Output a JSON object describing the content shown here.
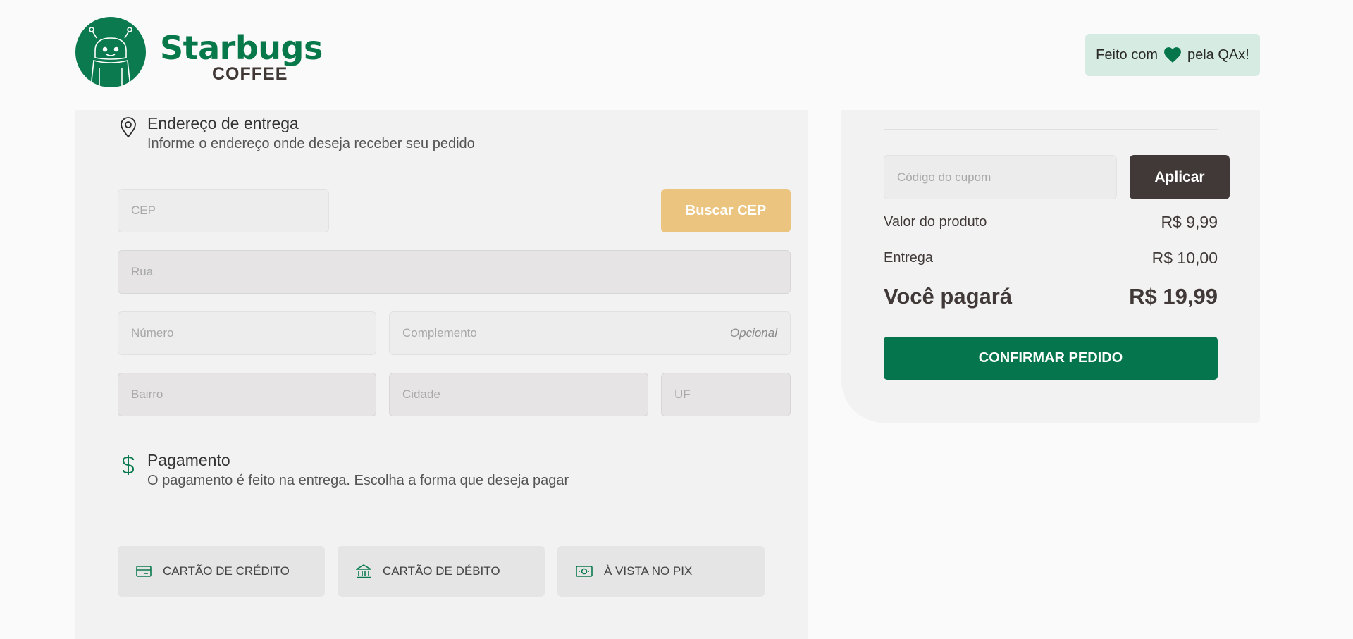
{
  "brand": {
    "name": "Starbugs",
    "sub": "COFFEE"
  },
  "badge": {
    "prefix": "Feito com",
    "suffix": "pela QAx!",
    "icon": "heart-icon"
  },
  "address": {
    "title": "Endereço de entrega",
    "subtitle": "Informe o endereço onde deseja receber seu pedido",
    "icon": "map-pin-icon",
    "fields": {
      "cep": "CEP",
      "rua": "Rua",
      "numero": "Número",
      "complemento": "Complemento",
      "complemento_tag": "Opcional",
      "bairro": "Bairro",
      "cidade": "Cidade",
      "uf": "UF"
    },
    "search_button": "Buscar CEP"
  },
  "payment": {
    "title": "Pagamento",
    "subtitle": "O pagamento é feito na entrega. Escolha a forma que deseja pagar",
    "icon": "dollar-icon",
    "options": [
      {
        "label": "CARTÃO DE CRÉDITO",
        "icon": "credit-card-icon"
      },
      {
        "label": "CARTÃO DE DÉBITO",
        "icon": "bank-icon"
      },
      {
        "label": "À VISTA NO PIX",
        "icon": "money-icon"
      }
    ]
  },
  "summary": {
    "coupon_placeholder": "Código do cupom",
    "apply_button": "Aplicar",
    "product_label": "Valor do produto",
    "product_value": "R$ 9,99",
    "delivery_label": "Entrega",
    "delivery_value": "R$ 10,00",
    "total_label": "Você pagará",
    "total_value": "R$ 19,99",
    "confirm_button": "CONFIRMAR PEDIDO"
  },
  "colors": {
    "brand_green": "#04754d",
    "dark": "#403937",
    "cep_button": "#ebc57f",
    "badge_bg": "#d6ebe1"
  }
}
